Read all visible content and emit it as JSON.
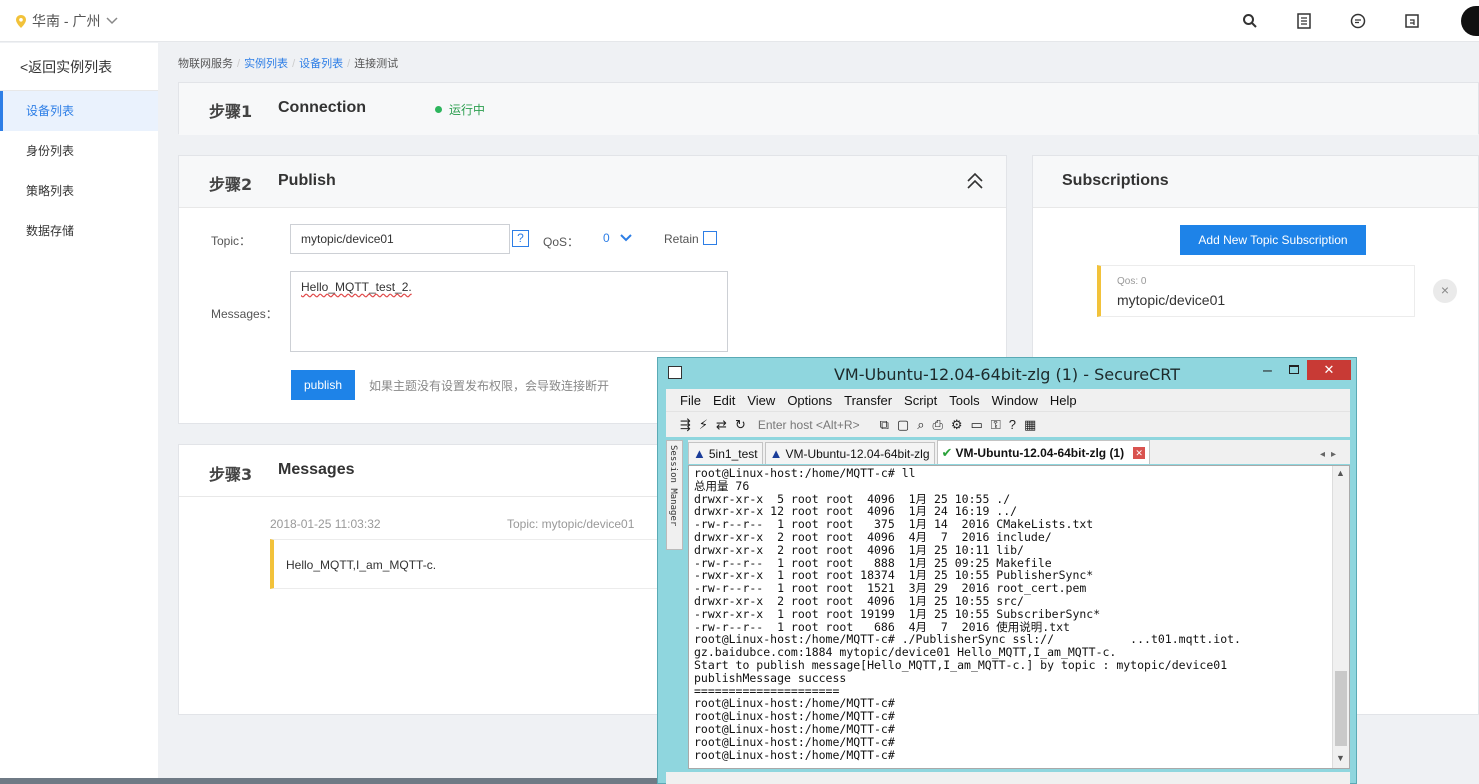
{
  "header": {
    "region": "华南 - 广州",
    "icons": [
      "search-icon",
      "document-icon",
      "chat-icon",
      "upload-icon"
    ]
  },
  "sidebar": {
    "back": "<返回实例列表",
    "items": [
      {
        "label": "设备列表",
        "active": true
      },
      {
        "label": "身份列表",
        "active": false
      },
      {
        "label": "策略列表",
        "active": false
      },
      {
        "label": "数据存储",
        "active": false
      }
    ]
  },
  "breadcrumb": {
    "items": [
      "物联网服务",
      "实例列表",
      "设备列表",
      "连接测试"
    ]
  },
  "step1": {
    "step": "步骤1",
    "title": "Connection",
    "status": "运行中",
    "status_color": "#2db55d"
  },
  "step2": {
    "step": "步骤2",
    "title": "Publish",
    "topic_label": "Topic：",
    "topic_value": "mytopic/device01",
    "help": "?",
    "qos_label": "QoS：",
    "qos_value": "0",
    "retain_label": "Retain",
    "messages_label": "Messages：",
    "message_value": "Hello_MQTT_test_2.",
    "publish_button": "publish",
    "hint": "如果主题没有设置发布权限，会导致连接断开"
  },
  "subscriptions": {
    "title": "Subscriptions",
    "add_button": "Add New Topic Subscription",
    "item_qos": "Qos: 0",
    "item_topic": "mytopic/device01"
  },
  "step3": {
    "step": "步骤3",
    "title": "Messages",
    "time": "2018-01-25 11:03:32",
    "topic": "Topic: mytopic/device01",
    "body": "Hello_MQTT,I_am_MQTT-c."
  },
  "crt": {
    "title": "VM-Ubuntu-12.04-64bit-zlg (1) - SecureCRT",
    "menu": [
      "File",
      "Edit",
      "View",
      "Options",
      "Transfer",
      "Script",
      "Tools",
      "Window",
      "Help"
    ],
    "host_placeholder": "Enter host <Alt+R>",
    "session_manager": "Session Manager",
    "tabs": [
      "5in1_test",
      "VM-Ubuntu-12.04-64bit-zlg",
      "VM-Ubuntu-12.04-64bit-zlg (1)"
    ],
    "terminal_lines": [
      "root@Linux-host:/home/MQTT-c# ll",
      "总用量 76",
      "drwxr-xr-x  5 root root  4096  1月 25 10:55 ./",
      "drwxr-xr-x 12 root root  4096  1月 24 16:19 ../",
      "-rw-r--r--  1 root root   375  1月 14  2016 CMakeLists.txt",
      "drwxr-xr-x  2 root root  4096  4月  7  2016 include/",
      "drwxr-xr-x  2 root root  4096  1月 25 10:11 lib/",
      "-rw-r--r--  1 root root   888  1月 25 09:25 Makefile",
      "-rwxr-xr-x  1 root root 18374  1月 25 10:55 PublisherSync*",
      "-rw-r--r--  1 root root  1521  3月 29  2016 root_cert.pem",
      "drwxr-xr-x  2 root root  4096  1月 25 10:55 src/",
      "-rwxr-xr-x  1 root root 19199  1月 25 10:55 SubscriberSync*",
      "-rw-r--r--  1 root root   686  4月  7  2016 使用说明.txt",
      "root@Linux-host:/home/MQTT-c# ./PublisherSync ssl://           ...t01.mqtt.iot.",
      "gz.baidubce.com:1884 mytopic/device01 Hello_MQTT,I_am_MQTT-c.",
      "Start to publish message[Hello_MQTT,I_am_MQTT-c.] by topic : mytopic/device01",
      "publishMessage success",
      "=====================",
      "root@Linux-host:/home/MQTT-c#",
      "root@Linux-host:/home/MQTT-c#",
      "root@Linux-host:/home/MQTT-c#",
      "root@Linux-host:/home/MQTT-c#",
      "root@Linux-host:/home/MQTT-c#"
    ]
  },
  "colors": {
    "accent": "#1e83e8",
    "highlight": "#f2c23a",
    "crt_frame": "#8fd6de",
    "close_red": "#c83a35"
  }
}
